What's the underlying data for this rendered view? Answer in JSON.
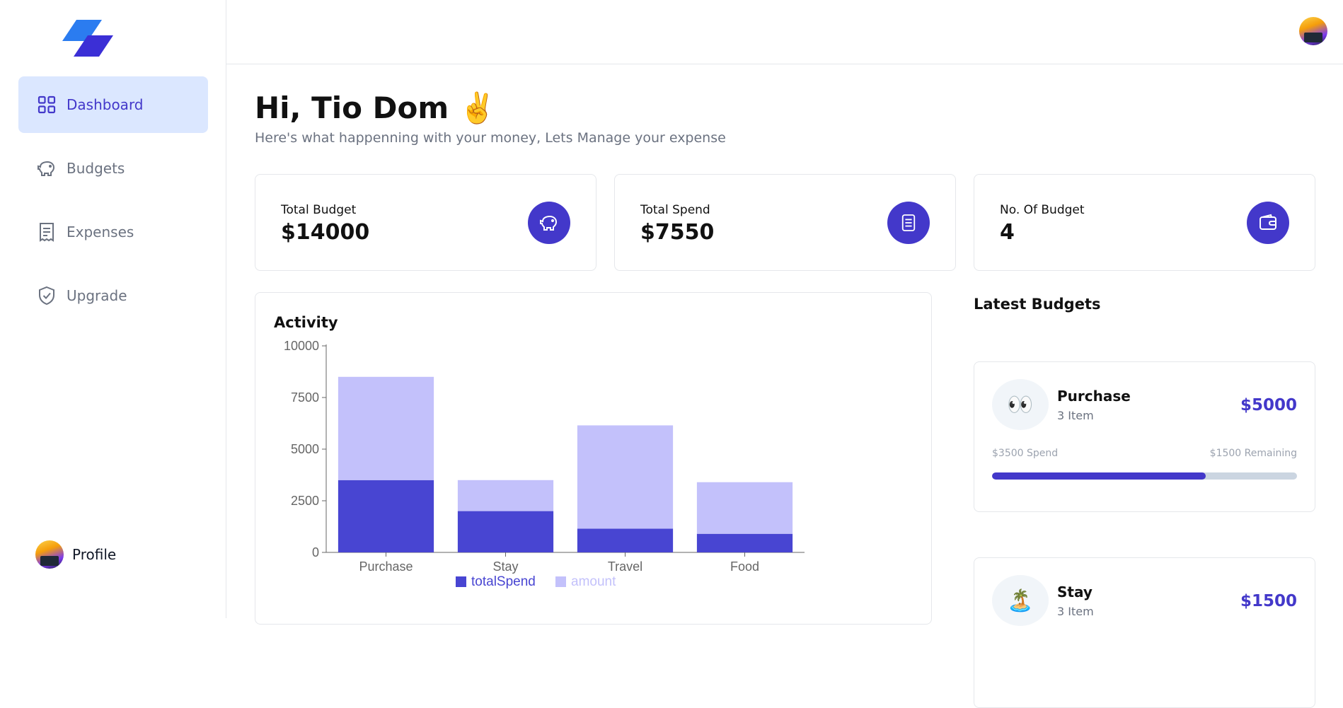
{
  "app": {
    "title": "Expense Tracker Dashboard"
  },
  "sidebar": {
    "items": [
      {
        "label": "Dashboard",
        "icon": "grid-icon",
        "active": true
      },
      {
        "label": "Budgets",
        "icon": "piggy-bank-icon",
        "active": false
      },
      {
        "label": "Expenses",
        "icon": "receipt-icon",
        "active": false
      },
      {
        "label": "Upgrade",
        "icon": "shield-check-icon",
        "active": false
      }
    ],
    "profile_label": "Profile"
  },
  "header": {
    "greeting": "Hi, Tio Dom ✌️",
    "subtitle": "Here's what happenning with your money, Lets Manage your expense"
  },
  "stats": [
    {
      "label": "Total Budget",
      "value": "$14000",
      "icon": "piggy-bank-icon"
    },
    {
      "label": "Total Spend",
      "value": "$7550",
      "icon": "receipt-icon"
    },
    {
      "label": "No. Of Budget",
      "value": "4",
      "icon": "wallet-icon"
    }
  ],
  "activity": {
    "title": "Activity"
  },
  "chart_data": {
    "type": "bar",
    "stacked": true,
    "categories": [
      "Purchase",
      "Stay",
      "Travel",
      "Food"
    ],
    "series": [
      {
        "name": "totalSpend",
        "values": [
          3500,
          2000,
          1150,
          900
        ],
        "color": "#4845d2"
      },
      {
        "name": "amount",
        "values": [
          5000,
          1500,
          5000,
          2500
        ],
        "color": "#c3c1fb"
      }
    ],
    "yticks": [
      0,
      2500,
      5000,
      7500,
      10000
    ],
    "ylim": [
      0,
      10000
    ],
    "legend_position": "bottom"
  },
  "latest": {
    "title": "Latest Budgets",
    "budgets": [
      {
        "emoji": "👀",
        "name": "Purchase",
        "items": "3 Item",
        "amount": "$5000",
        "spend": "$3500 Spend",
        "remaining": "$1500 Remaining",
        "progress": 0.7
      },
      {
        "emoji": "🏝️",
        "name": "Stay",
        "items": "3 Item",
        "amount": "$1500",
        "spend": "",
        "remaining": "",
        "progress": 0
      }
    ]
  },
  "colors": {
    "accent": "#4338ca",
    "active_bg": "#dbe7ff",
    "logo_light": "#2563eb",
    "logo_dark": "#3730d6"
  }
}
